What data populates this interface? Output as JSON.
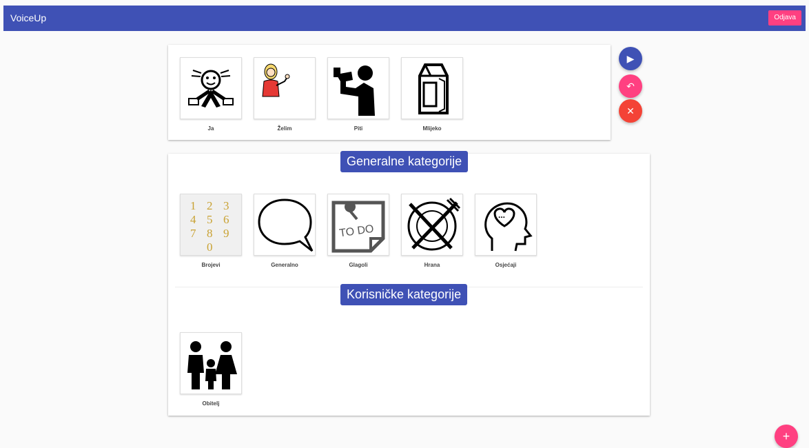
{
  "header": {
    "title": "VoiceUp",
    "logout_label": "Odjava"
  },
  "sentence": {
    "items": [
      {
        "label": "Ja",
        "icon": "self-person-icon"
      },
      {
        "label": "Želim",
        "icon": "woman-wanting-icon"
      },
      {
        "label": "Piti",
        "icon": "drinking-person-icon"
      },
      {
        "label": "Mlijeko",
        "icon": "milk-carton-icon"
      }
    ]
  },
  "actions": {
    "play_icon": "play-icon",
    "undo_icon": "undo-icon",
    "clear_icon": "close-icon",
    "add_icon": "plus-icon"
  },
  "general_categories": {
    "title": "Generalne kategorije",
    "items": [
      {
        "label": "Brojevi",
        "icon": "numbers-icon",
        "digits": [
          "1",
          "2",
          "3",
          "4",
          "5",
          "6",
          "7",
          "8",
          "9",
          "0"
        ]
      },
      {
        "label": "Generalno",
        "icon": "speech-bubble-icon"
      },
      {
        "label": "Glagoli",
        "icon": "todo-note-icon",
        "note_text": "TO DO"
      },
      {
        "label": "Hrana",
        "icon": "plate-cutlery-icon"
      },
      {
        "label": "Osjećaji",
        "icon": "head-heart-icon",
        "bubble_text": "..."
      }
    ]
  },
  "user_categories": {
    "title": "Korisničke kategorije",
    "items": [
      {
        "label": "Obitelj",
        "icon": "family-icon"
      }
    ]
  },
  "colors": {
    "primary": "#3f51b5",
    "accent": "#ff4081",
    "danger": "#f44336"
  }
}
